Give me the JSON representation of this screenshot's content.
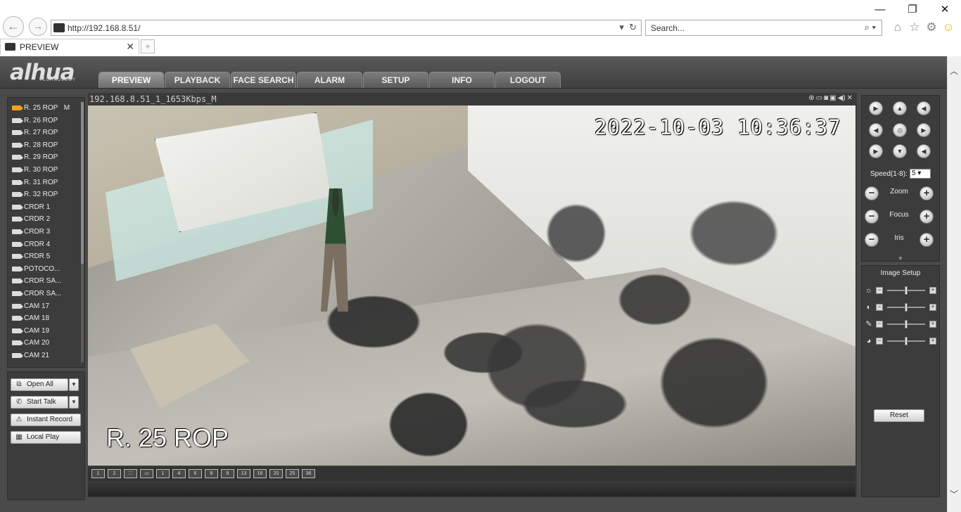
{
  "browser": {
    "url": "http://192.168.8.51/",
    "search_placeholder": "Search...",
    "tab_title": "PREVIEW",
    "back_glyph": "←",
    "forward_glyph": "→"
  },
  "nav": {
    "logo": "alhua",
    "logo_sub": "TECHNOLOGY",
    "tabs": [
      "PREVIEW",
      "PLAYBACK",
      "FACE SEARCH",
      "ALARM",
      "SETUP",
      "INFO",
      "LOGOUT"
    ],
    "active_tab": "PREVIEW"
  },
  "cameras": {
    "items": [
      "R. 25 ROP",
      "R. 26 ROP",
      "R. 27 ROP",
      "R. 28 ROP",
      "R. 29 ROP",
      "R. 30 ROP",
      "R. 31 ROP",
      "R. 32 ROP",
      "CRDR 1",
      "CRDR 2",
      "CRDR 3",
      "CRDR 4",
      "CRDR 5",
      "POTOCO...",
      "CRDR SA...",
      "CRDR SA...",
      "CAM 17",
      "CAM 18",
      "CAM 19",
      "CAM 20",
      "CAM 21"
    ],
    "active_suffix": "M"
  },
  "controls": {
    "open_all": "Open All",
    "start_talk": "Start Talk",
    "instant_record": "Instant Record",
    "local_play": "Local Play"
  },
  "video": {
    "stream_title": "192.168.8.51_1_1653Kbps_M",
    "timestamp": "2022-10-03 10:36:37",
    "channel_name": "R. 25 ROP"
  },
  "split_icons": [
    "1",
    "2",
    "⛶",
    "▭",
    "1",
    "4",
    "6",
    "8",
    "9",
    "13",
    "16",
    "20",
    "25",
    "36"
  ],
  "ptz": {
    "speed_label": "Speed(1-8):",
    "speed_value": "5",
    "zoom_label": "Zoom",
    "focus_label": "Focus",
    "iris_label": "Iris"
  },
  "image_setup": {
    "title": "Image Setup",
    "reset_label": "Reset",
    "sliders": [
      {
        "name": "brightness",
        "level": 0.5
      },
      {
        "name": "contrast",
        "level": 0.5
      },
      {
        "name": "saturation",
        "level": 0.5
      },
      {
        "name": "hue",
        "level": 0.5
      }
    ]
  }
}
